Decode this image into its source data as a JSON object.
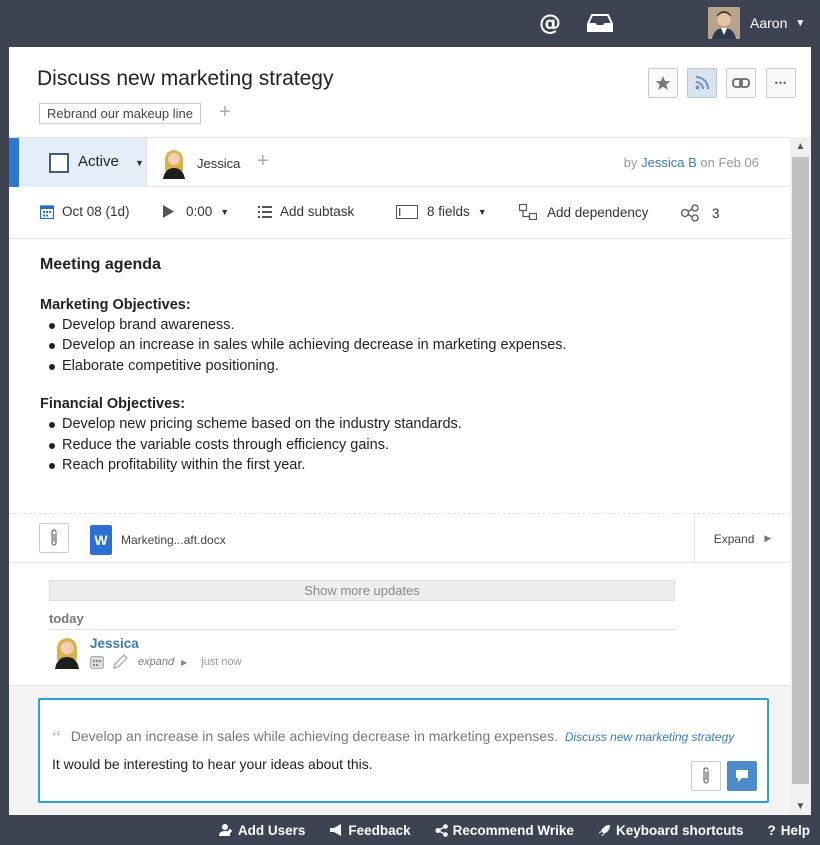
{
  "topbar": {
    "mentions_icon": "at-icon",
    "mentions_glyph": "@",
    "inbox_icon": "inbox-icon",
    "user_name": "Aaron"
  },
  "task": {
    "title": "Discuss new marketing strategy",
    "parent_folder": "Rebrand our makeup line",
    "actions": [
      "star-icon",
      "rss-icon",
      "link-icon",
      "more-icon"
    ],
    "more_glyph": "•••",
    "status": "Active",
    "assignee": "Jessica",
    "author_prefix": "by",
    "author": "Jessica B",
    "date_prefix": "on",
    "created": "Feb 06"
  },
  "meta": {
    "date": "Oct 08 (1d)",
    "timer": "0:00",
    "add_subtask": "Add subtask",
    "fields": "8 fields",
    "add_dependency": "Add dependency",
    "shares": "3"
  },
  "description": {
    "heading": "Meeting agenda",
    "sections": [
      {
        "title": "Marketing Objectives:",
        "items": [
          "Develop brand awareness.",
          "Develop an increase in sales while achieving decrease in marketing expenses.",
          "Elaborate competitive positioning."
        ]
      },
      {
        "title": "Financial Objectives:",
        "items": [
          "Develop new pricing scheme based on the industry standards.",
          "Reduce the variable costs through efficiency gains.",
          "Reach profitability within the first year."
        ]
      }
    ]
  },
  "attachments": {
    "word_glyph": "W",
    "file_name": "Marketing...aft.docx",
    "expand_label": "Expand"
  },
  "updates": {
    "show_more": "Show more updates",
    "day_label": "today",
    "author": "Jessica",
    "expand": "expand",
    "time": "just now"
  },
  "comment": {
    "quote_text": "Develop an increase in sales while achieving decrease in marketing expenses.",
    "quote_link": "Discuss new marketing strategy",
    "text": "It would be interesting to hear your ideas about this."
  },
  "footer": {
    "add_users": "Add Users",
    "feedback": "Feedback",
    "recommend": "Recommend Wrike",
    "shortcuts": "Keyboard shortcuts",
    "help": "Help"
  },
  "colors": {
    "accent": "#2b7ad2",
    "link": "#3c79b8",
    "topbar": "#3d4350",
    "comment_border": "#2aa0d8"
  }
}
